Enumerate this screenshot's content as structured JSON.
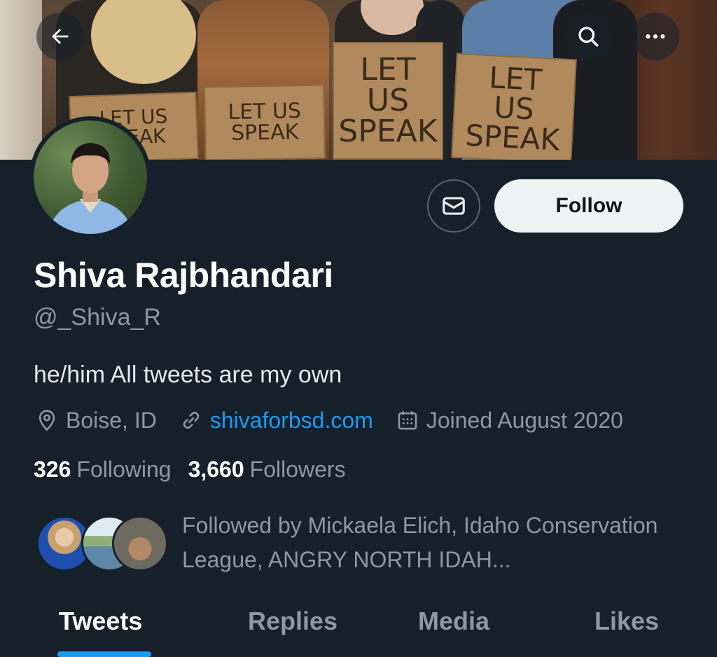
{
  "header": {
    "back_icon": "arrow-left-icon",
    "search_icon": "search-icon",
    "more_icon": "more-horizontal-icon"
  },
  "banner": {
    "signs": [
      "LET US\nSPEAK",
      "LET US\nSPEAK",
      "LET\nUS\nSPEAK",
      "LET\nUS\nSPEAK"
    ]
  },
  "profile": {
    "display_name": "Shiva Rajbhandari",
    "handle": "@_Shiva_R",
    "bio": "he/him All tweets are my own",
    "location": "Boise, ID",
    "website": "shivaforbsd.com",
    "joined": "Joined August 2020",
    "following_count": "326",
    "following_label": "Following",
    "followers_count": "3,660",
    "followers_label": "Followers"
  },
  "actions": {
    "message_icon": "mail-icon",
    "follow_label": "Follow"
  },
  "followed_by": {
    "text": "Followed by Mickaela Elich, Idaho Conservation League, ANGRY NORTH IDAH..."
  },
  "tabs": [
    {
      "label": "Tweets",
      "active": true
    },
    {
      "label": "Replies",
      "active": false
    },
    {
      "label": "Media",
      "active": false
    },
    {
      "label": "Likes",
      "active": false
    }
  ],
  "colors": {
    "background": "#15202b",
    "accent": "#1d9bf0",
    "muted": "#8b98a5",
    "follow_bg": "#eff3f4"
  }
}
